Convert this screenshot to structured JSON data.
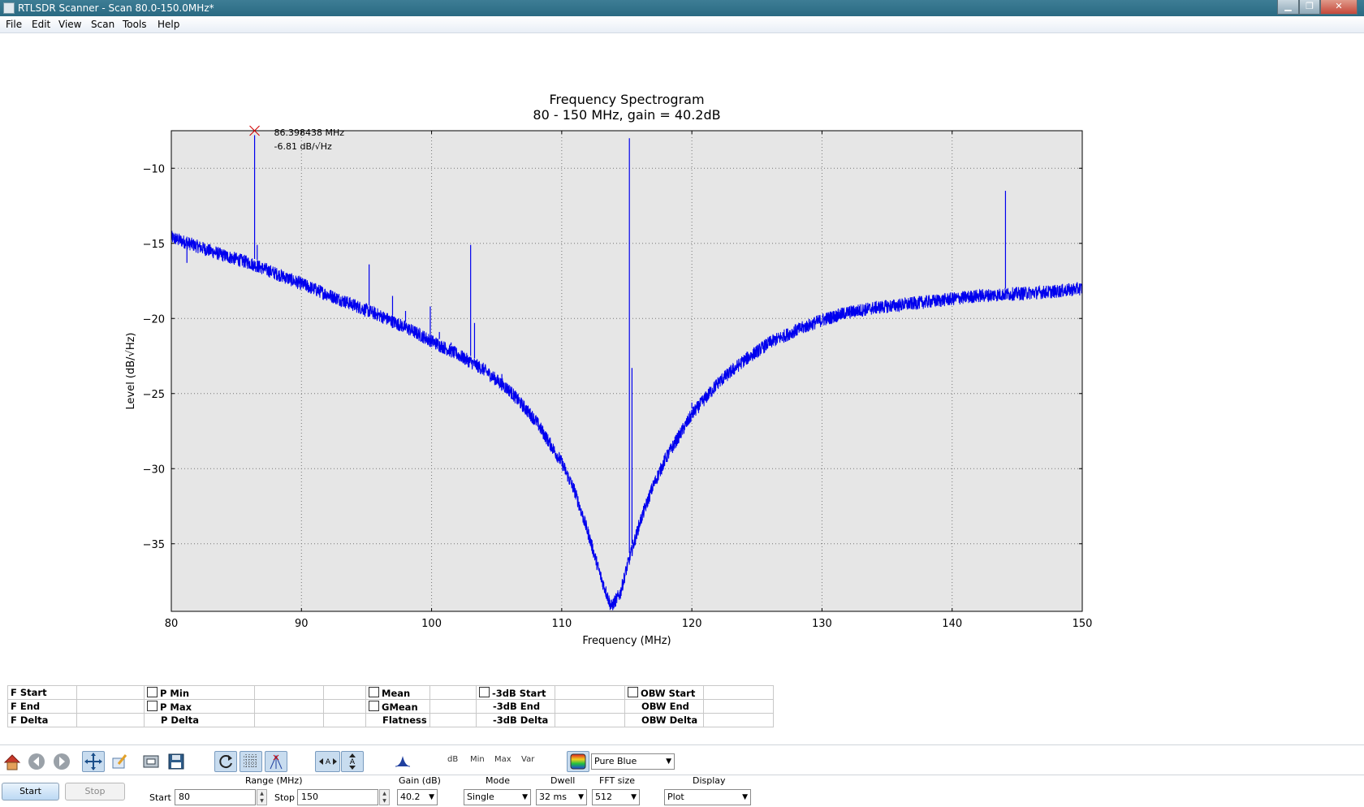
{
  "window": {
    "title": "RTLSDR Scanner - Scan 80.0-150.0MHz*",
    "minimize": "▁",
    "maximize": "❐",
    "close": "✕"
  },
  "menu": [
    "File",
    "Edit",
    "View",
    "Scan",
    "Tools",
    "Help"
  ],
  "chart_data": {
    "type": "line",
    "title": "Frequency Spectrogram",
    "subtitle": "80 - 150 MHz, gain = 40.2dB",
    "xlabel": "Frequency (MHz)",
    "ylabel": "Level (dB/√Hz)",
    "xlim": [
      80,
      150
    ],
    "ylim": [
      -39.5,
      -7.5
    ],
    "xticks": [
      80,
      90,
      100,
      110,
      120,
      130,
      140,
      150
    ],
    "yticks": [
      -10,
      -15,
      -20,
      -25,
      -30,
      -35
    ],
    "grid": true,
    "line_color": "#0000ee",
    "background": "#e6e6e6",
    "series": [
      {
        "baseline_points": [
          [
            80,
            -14.6
          ],
          [
            82,
            -15.2
          ],
          [
            84,
            -15.8
          ],
          [
            86,
            -16.3
          ],
          [
            88,
            -17
          ],
          [
            90,
            -17.7
          ],
          [
            92,
            -18.4
          ],
          [
            94,
            -19.1
          ],
          [
            96,
            -19.8
          ],
          [
            98,
            -20.6
          ],
          [
            100,
            -21.5
          ],
          [
            102,
            -22.4
          ],
          [
            104,
            -23.4
          ],
          [
            106,
            -24.8
          ],
          [
            108,
            -26.8
          ],
          [
            110,
            -29.6
          ],
          [
            111,
            -31.5
          ],
          [
            112,
            -34.2
          ],
          [
            113,
            -37.2
          ],
          [
            113.8,
            -39.2
          ],
          [
            114.5,
            -38.3
          ],
          [
            115,
            -36.6
          ],
          [
            116,
            -33.6
          ],
          [
            117,
            -31.2
          ],
          [
            118,
            -29.3
          ],
          [
            120,
            -26.4
          ],
          [
            122,
            -24.3
          ],
          [
            124,
            -22.8
          ],
          [
            126,
            -21.6
          ],
          [
            128,
            -20.8
          ],
          [
            130,
            -20.1
          ],
          [
            132,
            -19.6
          ],
          [
            134,
            -19.3
          ],
          [
            136,
            -19.1
          ],
          [
            138,
            -18.9
          ],
          [
            140,
            -18.7
          ],
          [
            142,
            -18.5
          ],
          [
            144,
            -18.4
          ],
          [
            146,
            -18.3
          ],
          [
            148,
            -18.2
          ],
          [
            150,
            -18.0
          ]
        ],
        "spikes": [
          [
            86.4,
            -7.8
          ],
          [
            86.6,
            -15.1
          ],
          [
            81.2,
            -16.3
          ],
          [
            95.2,
            -16.4
          ],
          [
            97.0,
            -18.5
          ],
          [
            98.0,
            -19.5
          ],
          [
            99.9,
            -19.2
          ],
          [
            100.6,
            -20.9
          ],
          [
            101.5,
            -21.6
          ],
          [
            103.0,
            -15.1
          ],
          [
            103.3,
            -20.3
          ],
          [
            105.4,
            -23.7
          ],
          [
            115.2,
            -8.0
          ],
          [
            115.4,
            -23.3
          ],
          [
            120.0,
            -25.6
          ],
          [
            144.1,
            -11.5
          ]
        ]
      }
    ],
    "annotation": {
      "freq": "86.398438 MHz",
      "level": "-6.81 dB/√Hz",
      "x": 86.398438,
      "y": -6.81
    }
  },
  "measure_table": {
    "c1": [
      "F Start",
      "F End",
      "F Delta"
    ],
    "c2": [
      "P Min",
      "P Max",
      "P Delta"
    ],
    "c3": [
      "Mean",
      "GMean",
      "Flatness"
    ],
    "c4": [
      "-3dB Start",
      "-3dB End",
      "-3dB Delta"
    ],
    "c5": [
      "OBW Start",
      "OBW End",
      "OBW Delta"
    ]
  },
  "toolbar": {
    "home": "home-icon",
    "back": "back-arrow-icon",
    "forward": "forward-arrow-icon",
    "pan": "pan-icon",
    "edit": "edit-icon",
    "subplots": "subplot-config-icon",
    "save": "save-icon",
    "auto_refresh": "refresh-icon",
    "grid": "grid-icon",
    "peak": "peak-marker-icon",
    "scale_x": "scale-x-icon",
    "scale_y": "scale-y-icon",
    "fade": "fade-icon",
    "db_label": "dB",
    "min_label": "Min",
    "max_label": "Max",
    "var_label": "Var",
    "colour_map": "Pure Blue"
  },
  "controls": {
    "start_button": "Start",
    "stop_button": "Stop",
    "range_label": "Range (MHz)",
    "start_label": "Start",
    "start_value": "80",
    "stop_label": "Stop",
    "stop_value": "150",
    "gain_label": "Gain (dB)",
    "gain_value": "40.2",
    "mode_label": "Mode",
    "mode_value": "Single",
    "dwell_label": "Dwell",
    "dwell_value": "32 ms",
    "fft_label": "FFT size",
    "fft_value": "512",
    "display_label": "Display",
    "display_value": "Plot"
  }
}
